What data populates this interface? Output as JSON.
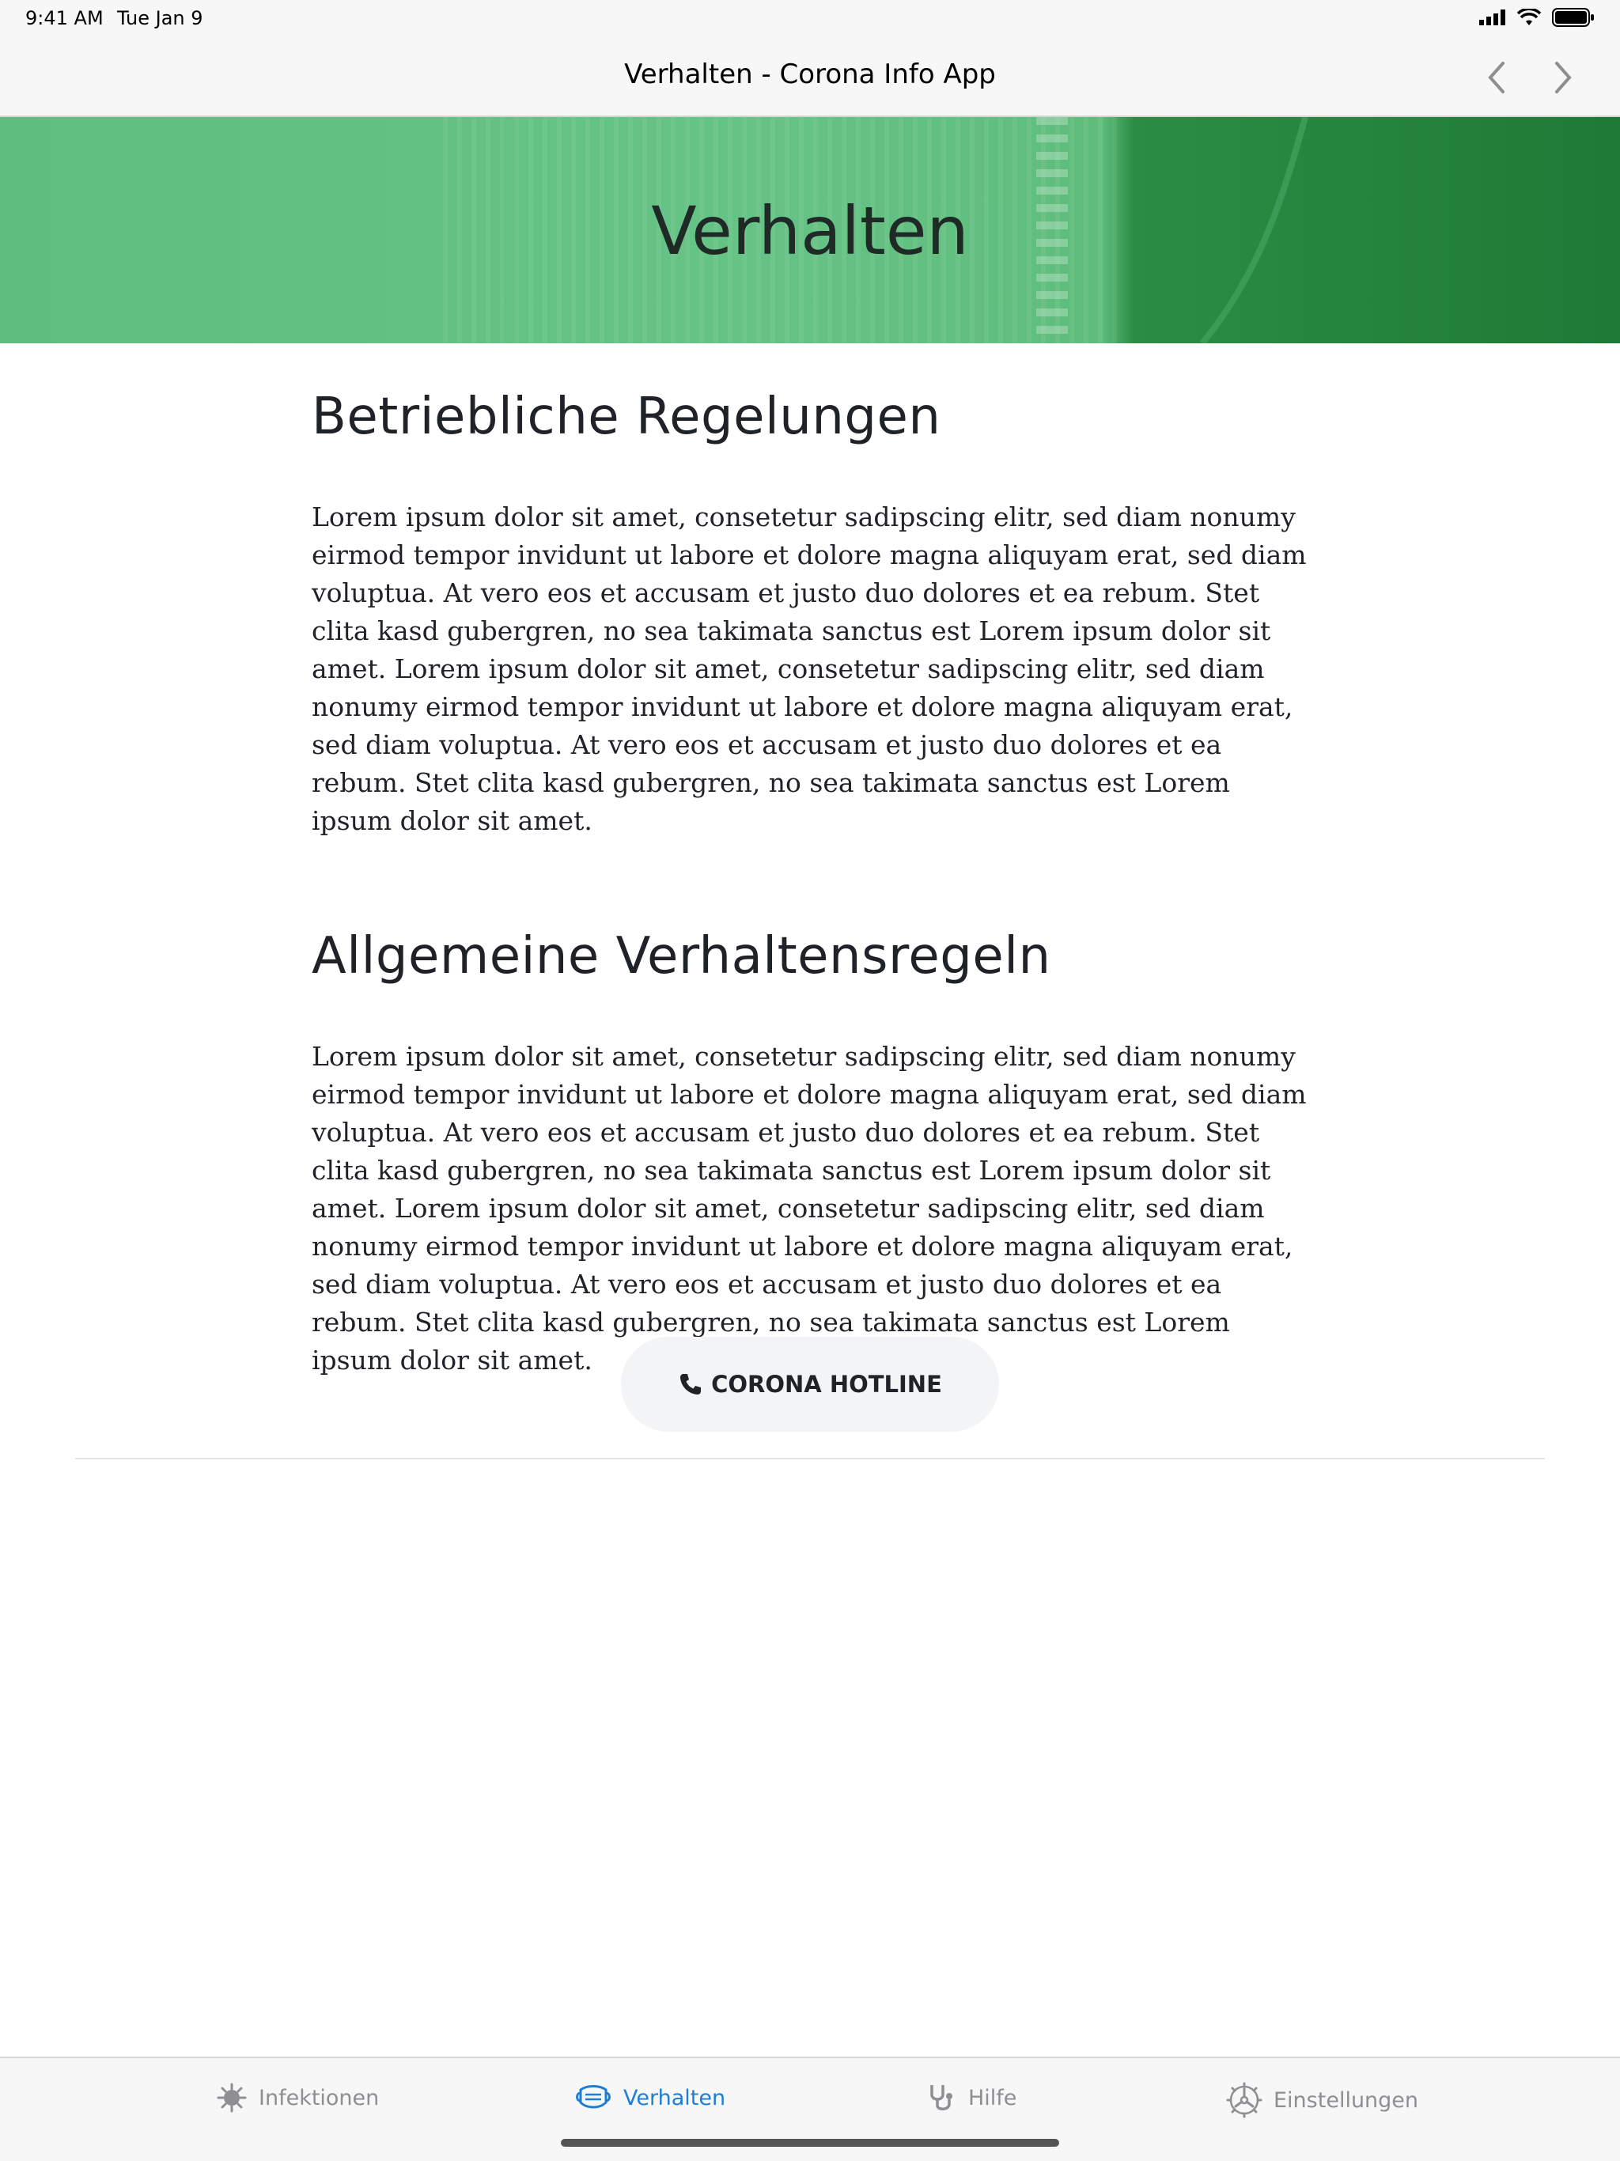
{
  "status_bar": {
    "time": "9:41 AM",
    "date": "Tue Jan 9"
  },
  "nav": {
    "title": "Verhalten - Corona Info App"
  },
  "hero": {
    "title": "Verhalten"
  },
  "sections": [
    {
      "heading": "Betriebliche Regelungen",
      "body": "Lorem ipsum dolor sit amet, consetetur sadipscing elitr, sed diam nonumy eirmod tempor invidunt ut labore et dolore magna aliquyam erat, sed diam voluptua. At vero eos et accusam et justo duo dolores et ea rebum. Stet clita kasd gubergren, no sea takimata sanctus est Lorem ipsum dolor sit amet. Lorem ipsum dolor sit amet, consetetur sadipscing elitr, sed diam nonumy eirmod tempor invidunt ut labore et dolore magna aliquyam erat, sed diam voluptua. At vero eos et accusam et justo duo dolores et ea rebum. Stet clita kasd gubergren, no sea takimata sanctus est Lorem ipsum dolor sit amet."
    },
    {
      "heading": "Allgemeine Verhaltensregeln",
      "body": "Lorem ipsum dolor sit amet, consetetur sadipscing elitr, sed diam nonumy eirmod tempor invidunt ut labore et dolore magna aliquyam erat, sed diam voluptua. At vero eos et accusam et justo duo dolores et ea rebum. Stet clita kasd gubergren, no sea takimata sanctus est Lorem ipsum dolor sit amet. Lorem ipsum dolor sit amet, consetetur sadipscing elitr, sed diam nonumy eirmod tempor invidunt ut labore et dolore magna aliquyam erat, sed diam voluptua. At vero eos et accusam et justo duo dolores et ea rebum. Stet clita kasd gubergren, no sea takimata sanctus est Lorem ipsum dolor sit amet."
    }
  ],
  "hotline": {
    "icon": "phone-icon",
    "label": "CORONA HOTLINE"
  },
  "tabs": [
    {
      "label": "Infektionen",
      "icon": "virus-icon"
    },
    {
      "label": "Verhalten",
      "icon": "mask-icon",
      "active": true
    },
    {
      "label": "Hilfe",
      "icon": "stethoscope-icon"
    },
    {
      "label": "Einstellungen",
      "icon": "gear-icon"
    }
  ],
  "colors": {
    "accent": "#1c7ed6",
    "hero_green": "#5fbe7f",
    "tab_inactive": "#8e8e93"
  }
}
